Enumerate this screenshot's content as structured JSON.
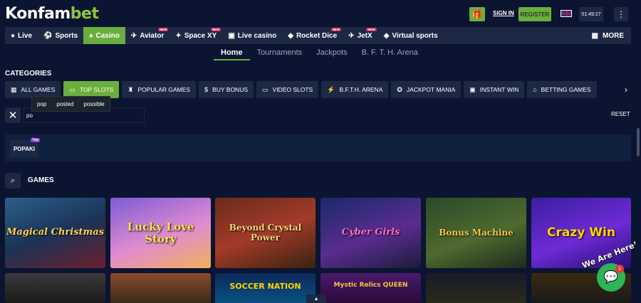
{
  "header": {
    "logo_main": "Konfam",
    "logo_accent": "bet",
    "signin_label": "SIGN IN",
    "register_label": "REGISTER",
    "time": "01:49:27",
    "gift_icon": "🎁",
    "menu_icon": "⋮",
    "language": "English (UK)"
  },
  "nav": {
    "items": [
      {
        "label": "Live",
        "icon": "●",
        "badge": ""
      },
      {
        "label": "Sports",
        "icon": "⚽",
        "badge": ""
      },
      {
        "label": "Casino",
        "icon": "♠",
        "badge": "",
        "active": true
      },
      {
        "label": "Aviator",
        "icon": "✈",
        "badge": "NEW"
      },
      {
        "label": "Space XY",
        "icon": "✦",
        "badge": "NEW"
      },
      {
        "label": "Live casino",
        "icon": "▣",
        "badge": ""
      },
      {
        "label": "Rocket Dice",
        "icon": "◆",
        "badge": "NEW"
      },
      {
        "label": "JetX",
        "icon": "✈",
        "badge": "NEW"
      },
      {
        "label": "Virtual sports",
        "icon": "◈",
        "badge": ""
      }
    ],
    "more_label": "MORE",
    "more_icon": "▦"
  },
  "subtabs": [
    "Home",
    "Tournaments",
    "Jackpots",
    "B. F. T. H. Arena"
  ],
  "categories": {
    "title": "CATEGORIES",
    "items": [
      {
        "label": "ALL GAMES",
        "icon": "▦"
      },
      {
        "label": "TOP SLOTS",
        "icon": "▭"
      },
      {
        "label": "POPULAR GAMES",
        "icon": "♜"
      },
      {
        "label": "BUY BONUS",
        "icon": "$"
      },
      {
        "label": "VIDEO SLOTS",
        "icon": "▭"
      },
      {
        "label": "B.F.T.H. ARENA",
        "icon": "⚡"
      },
      {
        "label": "JACKPOT MANIA",
        "icon": "✪"
      },
      {
        "label": "INSTANT WIN",
        "icon": "▣"
      },
      {
        "label": "BETTING GAMES",
        "icon": "⌂"
      }
    ],
    "arrow": "›"
  },
  "search": {
    "value": "po",
    "suggestions": [
      "pop",
      "posted",
      "possible"
    ],
    "reset_label": "RESET",
    "clear_icon": "✕"
  },
  "provider": {
    "name": "POPAKI",
    "badge": "Top"
  },
  "games": {
    "title": "GAMES",
    "search_icon": "⌕",
    "row1": [
      "Magical Christmas",
      "Lucky Love Story",
      "Beyond Crystal Power",
      "Cyber Girls",
      "Bonus Machine",
      "Crazy Win"
    ],
    "row2": [
      "",
      "",
      "SOCCER NATION",
      "Mystic Relics QUEEN",
      "",
      ""
    ]
  },
  "chat": {
    "label": "We Are Here!",
    "badge": "1",
    "icon": "💬"
  },
  "scroll_up_icon": "▲"
}
